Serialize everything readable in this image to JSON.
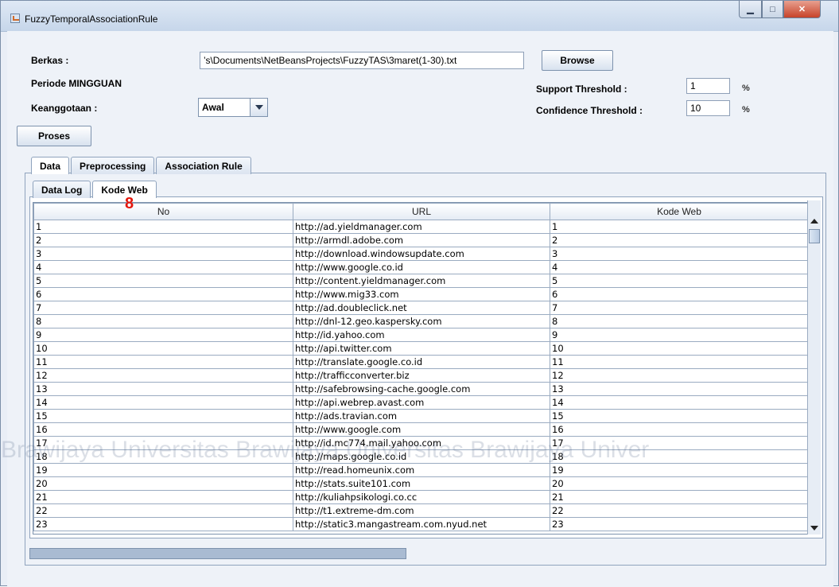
{
  "window": {
    "title": "FuzzyTemporalAssociationRule",
    "controls": {
      "minimize": "▁",
      "maximize": "□",
      "close": "✕"
    }
  },
  "form": {
    "berkas_label": "Berkas :",
    "berkas_value": "’s\\Documents\\NetBeansProjects\\FuzzyTAS\\3maret(1-30).txt",
    "browse_label": "Browse",
    "periode_label": "Periode MINGGUAN",
    "keanggotaan_label": "Keanggotaan :",
    "keanggotaan_value": "Awal",
    "support_label": "Support Threshold :",
    "support_value": "1",
    "support_unit": "%",
    "confidence_label": "Confidence Threshold :",
    "confidence_value": "10",
    "confidence_unit": "%",
    "proses_label": "Proses"
  },
  "tabs": {
    "main": [
      "Data",
      "Preprocessing",
      "Association Rule"
    ],
    "sub": [
      "Data Log",
      "Kode Web"
    ]
  },
  "annotation": "8",
  "table": {
    "headers": [
      "No",
      "URL",
      "Kode Web"
    ],
    "rows": [
      [
        "1",
        "http://ad.yieldmanager.com",
        "1"
      ],
      [
        "2",
        "http://armdl.adobe.com",
        "2"
      ],
      [
        "3",
        "http://download.windowsupdate.com",
        "3"
      ],
      [
        "4",
        "http://www.google.co.id",
        "4"
      ],
      [
        "5",
        "http://content.yieldmanager.com",
        "5"
      ],
      [
        "6",
        "http://www.mig33.com",
        "6"
      ],
      [
        "7",
        "http://ad.doubleclick.net",
        "7"
      ],
      [
        "8",
        "http://dnl-12.geo.kaspersky.com",
        "8"
      ],
      [
        "9",
        "http://id.yahoo.com",
        "9"
      ],
      [
        "10",
        "http://api.twitter.com",
        "10"
      ],
      [
        "11",
        "http://translate.google.co.id",
        "11"
      ],
      [
        "12",
        "http://trafficconverter.biz",
        "12"
      ],
      [
        "13",
        "http://safebrowsing-cache.google.com",
        "13"
      ],
      [
        "14",
        "http://api.webrep.avast.com",
        "14"
      ],
      [
        "15",
        "http://ads.travian.com",
        "15"
      ],
      [
        "16",
        "http://www.google.com",
        "16"
      ],
      [
        "17",
        "http://id.mc774.mail.yahoo.com",
        "17"
      ],
      [
        "18",
        "http://maps.google.co.id",
        "18"
      ],
      [
        "19",
        "http://read.homeunix.com",
        "19"
      ],
      [
        "20",
        "http://stats.suite101.com",
        "20"
      ],
      [
        "21",
        "http://kuliahpsikologi.co.cc",
        "21"
      ],
      [
        "22",
        "http://t1.extreme-dm.com",
        "22"
      ],
      [
        "23",
        "http://static3.mangastream.com.nyud.net",
        "23"
      ]
    ]
  },
  "watermark_text": "Brawijaya   Universitas Brawijaya   Universitas Brawijaya   Univer"
}
